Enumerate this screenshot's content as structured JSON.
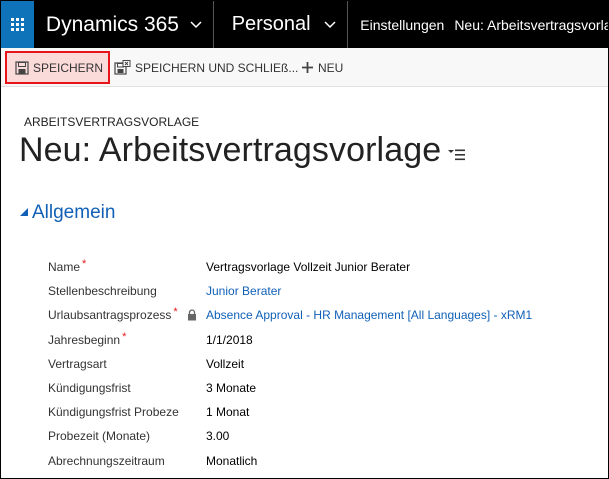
{
  "topnav": {
    "app_name": "Dynamics 365",
    "area_name": "Personal",
    "settings_label": "Einstellungen",
    "breadcrumb": "Neu: Arbeitsvertragsvorlage",
    "waffle_color": "#0f73b9"
  },
  "commandbar": {
    "save_label": "SPEICHERN",
    "save_close_label": "SPEICHERN UND SCHLIEß...",
    "new_label": "NEU"
  },
  "header": {
    "entity_label": "ARBEITSVERTRAGSVORLAGE",
    "title": "Neu: Arbeitsvertragsvorlage"
  },
  "section": {
    "toggle_icon": "triangle-collapse-icon",
    "title": "Allgemein"
  },
  "fields": [
    {
      "label": "Name",
      "required": true,
      "value": "Vertragsvorlage Vollzeit Junior Berater",
      "link": false,
      "locked": false
    },
    {
      "label": "Stellenbeschreibung",
      "required": false,
      "value": "Junior Berater",
      "link": true,
      "locked": false
    },
    {
      "label": "Urlaubsantragsprozess",
      "required": true,
      "value": "Absence Approval - HR Management [All Languages] - xRM1",
      "link": true,
      "locked": true
    },
    {
      "label": "Jahresbeginn",
      "required": true,
      "value": "1/1/2018",
      "link": false,
      "locked": false
    },
    {
      "label": "Vertragsart",
      "required": false,
      "value": "Vollzeit",
      "link": false,
      "locked": false
    },
    {
      "label": "Kündigungsfrist",
      "required": false,
      "value": "3 Monate",
      "link": false,
      "locked": false
    },
    {
      "label": "Kündigungsfrist Probeze",
      "required": false,
      "value": "1 Monat",
      "link": false,
      "locked": false
    },
    {
      "label": "Probezeit (Monate)",
      "required": false,
      "value": "3.00",
      "link": false,
      "locked": false
    },
    {
      "label": "Abrechnungszeitraum",
      "required": false,
      "value": "Monatlich",
      "link": false,
      "locked": false
    }
  ],
  "colors": {
    "accent_blue": "#1160b7",
    "required_red": "#e8141b",
    "save_highlight": "#fbdada"
  }
}
